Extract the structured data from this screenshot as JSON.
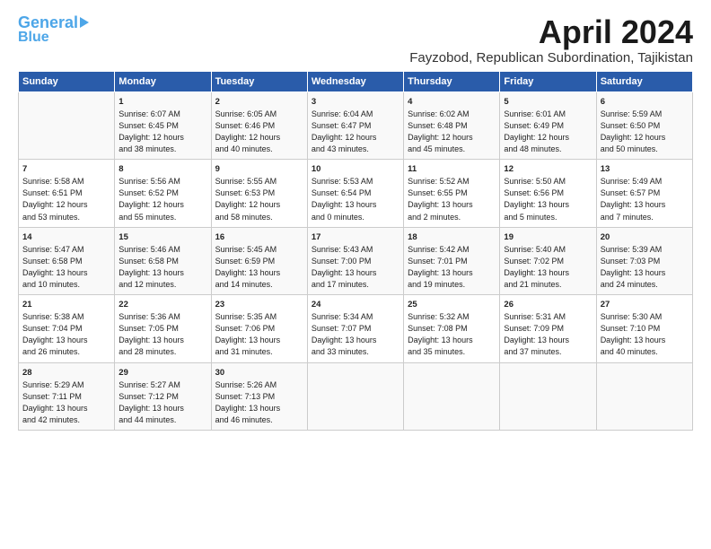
{
  "header": {
    "logo_line1": "General",
    "logo_line2": "Blue",
    "title": "April 2024",
    "subtitle": "Fayzobod, Republican Subordination, Tajikistan"
  },
  "columns": [
    "Sunday",
    "Monday",
    "Tuesday",
    "Wednesday",
    "Thursday",
    "Friday",
    "Saturday"
  ],
  "weeks": [
    [
      {
        "day": "",
        "content": ""
      },
      {
        "day": "1",
        "content": "Sunrise: 6:07 AM\nSunset: 6:45 PM\nDaylight: 12 hours\nand 38 minutes."
      },
      {
        "day": "2",
        "content": "Sunrise: 6:05 AM\nSunset: 6:46 PM\nDaylight: 12 hours\nand 40 minutes."
      },
      {
        "day": "3",
        "content": "Sunrise: 6:04 AM\nSunset: 6:47 PM\nDaylight: 12 hours\nand 43 minutes."
      },
      {
        "day": "4",
        "content": "Sunrise: 6:02 AM\nSunset: 6:48 PM\nDaylight: 12 hours\nand 45 minutes."
      },
      {
        "day": "5",
        "content": "Sunrise: 6:01 AM\nSunset: 6:49 PM\nDaylight: 12 hours\nand 48 minutes."
      },
      {
        "day": "6",
        "content": "Sunrise: 5:59 AM\nSunset: 6:50 PM\nDaylight: 12 hours\nand 50 minutes."
      }
    ],
    [
      {
        "day": "7",
        "content": "Sunrise: 5:58 AM\nSunset: 6:51 PM\nDaylight: 12 hours\nand 53 minutes."
      },
      {
        "day": "8",
        "content": "Sunrise: 5:56 AM\nSunset: 6:52 PM\nDaylight: 12 hours\nand 55 minutes."
      },
      {
        "day": "9",
        "content": "Sunrise: 5:55 AM\nSunset: 6:53 PM\nDaylight: 12 hours\nand 58 minutes."
      },
      {
        "day": "10",
        "content": "Sunrise: 5:53 AM\nSunset: 6:54 PM\nDaylight: 13 hours\nand 0 minutes."
      },
      {
        "day": "11",
        "content": "Sunrise: 5:52 AM\nSunset: 6:55 PM\nDaylight: 13 hours\nand 2 minutes."
      },
      {
        "day": "12",
        "content": "Sunrise: 5:50 AM\nSunset: 6:56 PM\nDaylight: 13 hours\nand 5 minutes."
      },
      {
        "day": "13",
        "content": "Sunrise: 5:49 AM\nSunset: 6:57 PM\nDaylight: 13 hours\nand 7 minutes."
      }
    ],
    [
      {
        "day": "14",
        "content": "Sunrise: 5:47 AM\nSunset: 6:58 PM\nDaylight: 13 hours\nand 10 minutes."
      },
      {
        "day": "15",
        "content": "Sunrise: 5:46 AM\nSunset: 6:58 PM\nDaylight: 13 hours\nand 12 minutes."
      },
      {
        "day": "16",
        "content": "Sunrise: 5:45 AM\nSunset: 6:59 PM\nDaylight: 13 hours\nand 14 minutes."
      },
      {
        "day": "17",
        "content": "Sunrise: 5:43 AM\nSunset: 7:00 PM\nDaylight: 13 hours\nand 17 minutes."
      },
      {
        "day": "18",
        "content": "Sunrise: 5:42 AM\nSunset: 7:01 PM\nDaylight: 13 hours\nand 19 minutes."
      },
      {
        "day": "19",
        "content": "Sunrise: 5:40 AM\nSunset: 7:02 PM\nDaylight: 13 hours\nand 21 minutes."
      },
      {
        "day": "20",
        "content": "Sunrise: 5:39 AM\nSunset: 7:03 PM\nDaylight: 13 hours\nand 24 minutes."
      }
    ],
    [
      {
        "day": "21",
        "content": "Sunrise: 5:38 AM\nSunset: 7:04 PM\nDaylight: 13 hours\nand 26 minutes."
      },
      {
        "day": "22",
        "content": "Sunrise: 5:36 AM\nSunset: 7:05 PM\nDaylight: 13 hours\nand 28 minutes."
      },
      {
        "day": "23",
        "content": "Sunrise: 5:35 AM\nSunset: 7:06 PM\nDaylight: 13 hours\nand 31 minutes."
      },
      {
        "day": "24",
        "content": "Sunrise: 5:34 AM\nSunset: 7:07 PM\nDaylight: 13 hours\nand 33 minutes."
      },
      {
        "day": "25",
        "content": "Sunrise: 5:32 AM\nSunset: 7:08 PM\nDaylight: 13 hours\nand 35 minutes."
      },
      {
        "day": "26",
        "content": "Sunrise: 5:31 AM\nSunset: 7:09 PM\nDaylight: 13 hours\nand 37 minutes."
      },
      {
        "day": "27",
        "content": "Sunrise: 5:30 AM\nSunset: 7:10 PM\nDaylight: 13 hours\nand 40 minutes."
      }
    ],
    [
      {
        "day": "28",
        "content": "Sunrise: 5:29 AM\nSunset: 7:11 PM\nDaylight: 13 hours\nand 42 minutes."
      },
      {
        "day": "29",
        "content": "Sunrise: 5:27 AM\nSunset: 7:12 PM\nDaylight: 13 hours\nand 44 minutes."
      },
      {
        "day": "30",
        "content": "Sunrise: 5:26 AM\nSunset: 7:13 PM\nDaylight: 13 hours\nand 46 minutes."
      },
      {
        "day": "",
        "content": ""
      },
      {
        "day": "",
        "content": ""
      },
      {
        "day": "",
        "content": ""
      },
      {
        "day": "",
        "content": ""
      }
    ]
  ]
}
